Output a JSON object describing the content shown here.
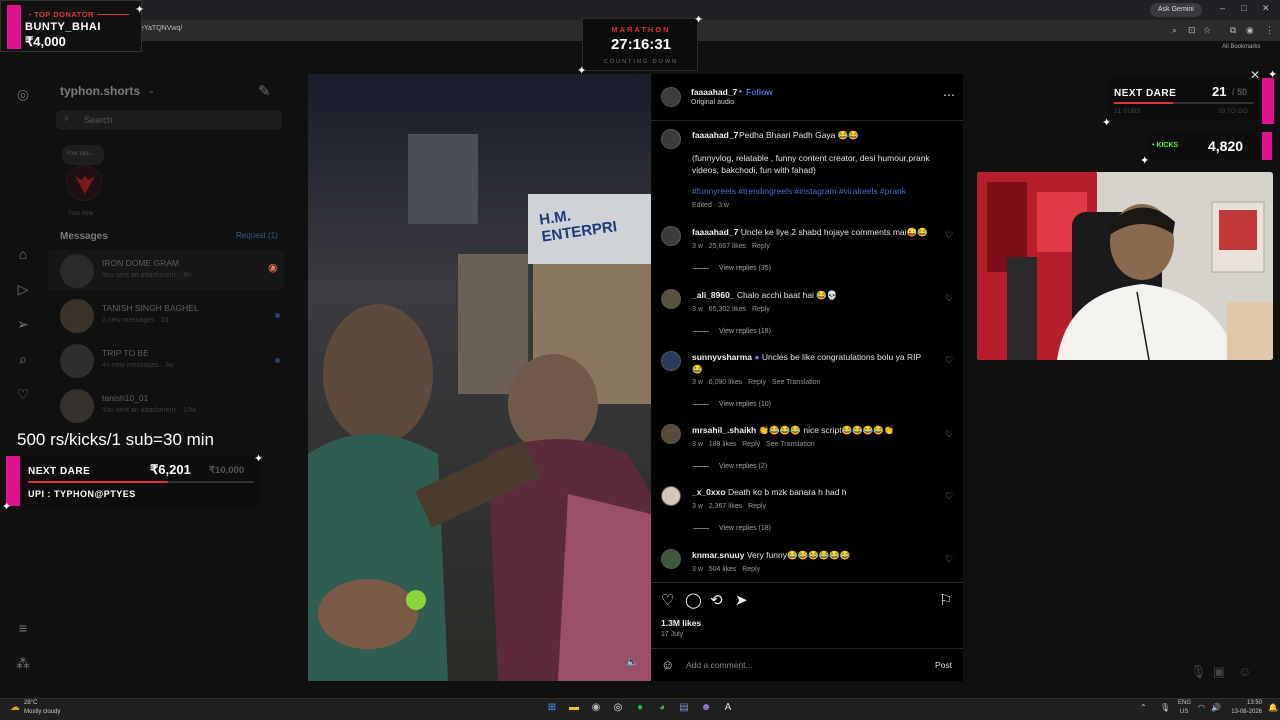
{
  "browser": {
    "url_fragment": "eYaTQNVwq/",
    "ask_gemini": "Ask Gemini",
    "all_bookmarks": "All Bookmarks"
  },
  "overlays": {
    "top_donator": {
      "label": "TOP DONATOR",
      "name": "BUNTY_BHAI",
      "amount": "₹4,000"
    },
    "marathon": {
      "title": "MARATHON",
      "time": "27:16:31",
      "subtitle": "COUNTING DOWN"
    },
    "next_dare_right": {
      "label": "NEXT DARE",
      "current": "21",
      "goal": "/ 50",
      "sub_label": "21 SUBS",
      "sub_right": "29 TO GO"
    },
    "kicks": {
      "label": "KICKS",
      "value": "4,820"
    },
    "rate_text": "500 rs/kicks/1 sub=30 min",
    "next_dare_left": {
      "label": "NEXT DARE",
      "current": "₹6,201",
      "goal": "₹10,000",
      "upi": "UPI : TYPHON@PTYES"
    }
  },
  "sidebar": {
    "username": "typhon.shorts",
    "search_placeholder": "Search",
    "note_bubble": "Your tam...",
    "note_label": "Your note",
    "messages_header": "Messages",
    "requests": "Request (1)",
    "threads": [
      {
        "name": "IRON DOME GRAM",
        "sub": "You sent an attachment. · 8h"
      },
      {
        "name": "TANISH SINGH BAGHEL",
        "sub": "2 new messages · 2d"
      },
      {
        "name": "TRIP TO BE",
        "sub": "4+ new messages · 3w"
      },
      {
        "name": "tanish10_01",
        "sub": "You sent an attachment. · 10w"
      }
    ]
  },
  "post": {
    "author": "faaaahad_7",
    "follow": "Follow",
    "audio": "Original audio",
    "caption_user": "faaaahad_7",
    "caption_title": "Pedha Bhaari Padh Gaya 😂😂",
    "caption_body": "(funnyvlog, relatable , funny content creator, desi humour,prank videos, bakchodi, fun with fahad)",
    "hashtags": "#funnyreels #trendingreels #instagram #viralreels #prank",
    "edited": "Edited · 3 w",
    "comments": [
      {
        "user": "faaaahad_7",
        "text": "Uncle ke liye 2 shabd hojaye comments mai😜😂",
        "age": "3 w",
        "likes": "25,667 likes",
        "reply": "Reply",
        "translation": "",
        "view_replies": "View replies (35)"
      },
      {
        "user": "_ali_8960_",
        "text": "Chalo acchi baat hai 😂💀",
        "age": "3 w",
        "likes": "65,302 likes",
        "reply": "Reply",
        "translation": "",
        "view_replies": "View replies (18)"
      },
      {
        "user": "sunnyvsharma",
        "text": "Uncles be like congratulations bolu ya RIP 😂",
        "age": "3 w",
        "likes": "6,090 likes",
        "reply": "Reply",
        "translation": "See Translation",
        "view_replies": "View replies (10)"
      },
      {
        "user": "mrsahil_.shaikh",
        "text": "👏😂😂😂 nice script😂😂😂😂👏",
        "age": "3 w",
        "likes": "189 likes",
        "reply": "Reply",
        "translation": "See Translation",
        "view_replies": "View replies (2)"
      },
      {
        "user": "_x_0xxo",
        "text": "Death ko b mzk banara h had h",
        "age": "3 w",
        "likes": "2,367 likes",
        "reply": "Reply",
        "translation": "",
        "view_replies": "View replies (18)"
      },
      {
        "user": "knmar.snuuy",
        "text": "Very funny😂😂😂😂😂😂",
        "age": "3 w",
        "likes": "504 likes",
        "reply": "Reply",
        "translation": "",
        "view_replies": ""
      }
    ],
    "likes": "1.3M likes",
    "date": "17 July",
    "add_comment": "Add a comment...",
    "post_btn": "Post"
  },
  "video_sign": "H.M. ENTERPRI",
  "taskbar": {
    "weather_temp": "28°C",
    "weather_desc": "Mostly cloudy",
    "lang": "ENG",
    "region": "US",
    "time": "13:50",
    "date": "13-08-2026"
  },
  "colors": {
    "accent_red": "#e0343c",
    "accent_pink": "#e0118e",
    "link_blue": "#4c6fd6",
    "kick_green": "#53fc18"
  }
}
